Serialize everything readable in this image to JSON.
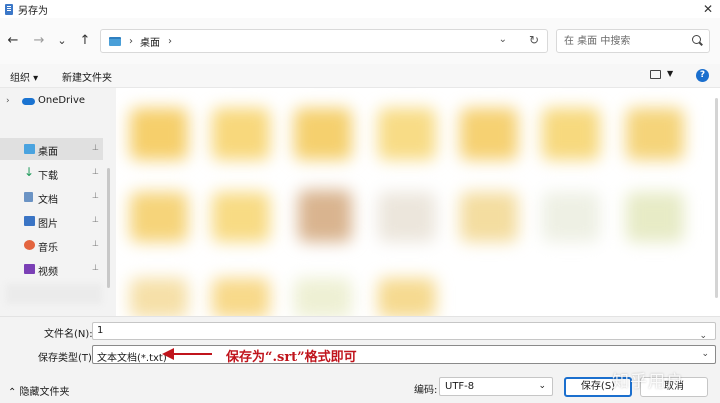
{
  "window": {
    "title": "另存为",
    "close_glyph": "✕"
  },
  "nav": {
    "back_glyph": "←",
    "forward_glyph": "→",
    "recent_glyph": "⌄",
    "up_glyph": "↑",
    "path_sep": "›",
    "crumb": "桌面",
    "refresh_glyph": "↻",
    "search_placeholder": "在 桌面 中搜索"
  },
  "toolbar": {
    "organize": "组织 ▾",
    "new_folder": "新建文件夹",
    "help": "?"
  },
  "sidebar": {
    "items": [
      {
        "label": "OneDrive",
        "icon": "cloud-icon",
        "expand": "›"
      },
      {
        "label": "桌面",
        "icon": "desktop-icon",
        "pin": "📌"
      },
      {
        "label": "下载",
        "icon": "download-icon",
        "pin": "📌",
        "glyph": "↓"
      },
      {
        "label": "文档",
        "icon": "document-icon",
        "pin": "📌"
      },
      {
        "label": "图片",
        "icon": "picture-icon",
        "pin": "📌"
      },
      {
        "label": "音乐",
        "icon": "music-icon",
        "pin": "📌"
      },
      {
        "label": "视频",
        "icon": "video-icon",
        "pin": "📌"
      }
    ]
  },
  "form": {
    "filename_label": "文件名(N):",
    "filename_value": "1",
    "filetype_label": "保存类型(T):",
    "filetype_value": "文本文档(*.txt)",
    "annotation": "保存为“.srt”格式即可"
  },
  "footer": {
    "hide_folders": "⌃ 隐藏文件夹",
    "encoding_label": "编码:",
    "encoding_value": "UTF-8",
    "save": "保存(S)",
    "cancel": "取消",
    "watermark": "知乎用户"
  },
  "colors": {
    "accent": "#1b6fce",
    "annotation": "#c0141c"
  }
}
